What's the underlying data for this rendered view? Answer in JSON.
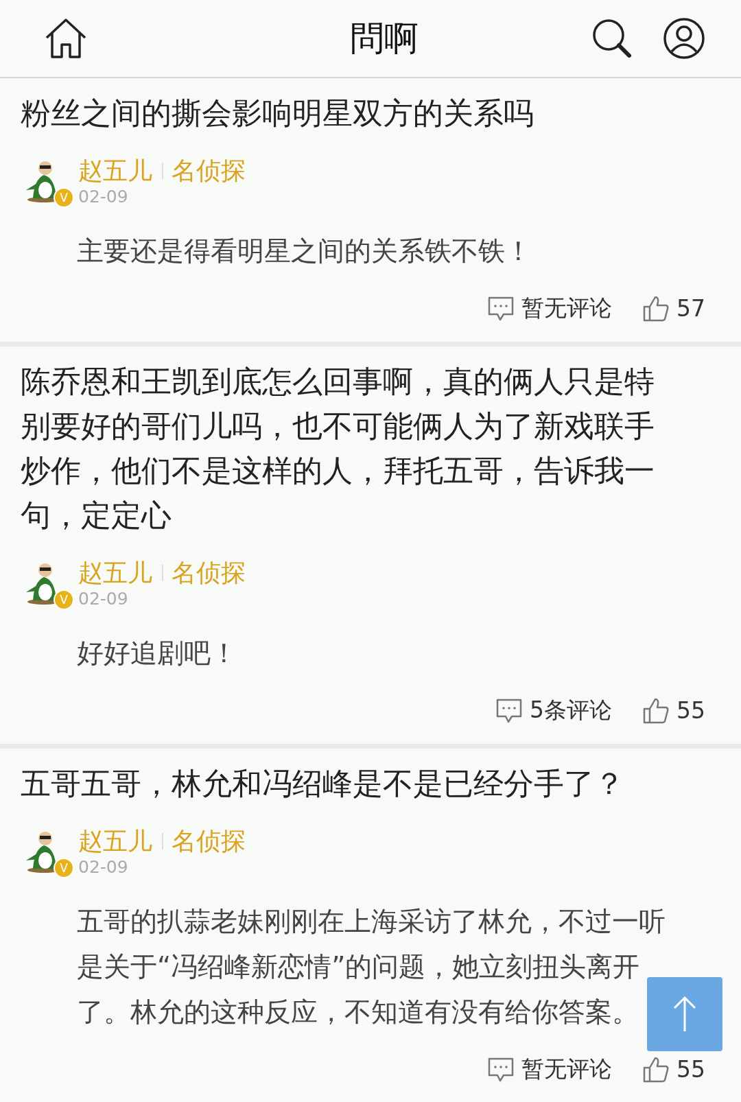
{
  "header": {
    "title": "問啊"
  },
  "posts": [
    {
      "question": "粉丝之间的撕会影响明星双方的关系吗",
      "author": {
        "name": "赵五儿",
        "role": "名侦探",
        "date": "02-09",
        "verified_mark": "V"
      },
      "answer": "主要还是得看明星之间的关系铁不铁！",
      "comments": "暂无评论",
      "likes": "57"
    },
    {
      "question": "陈乔恩和王凯到底怎么回事啊，真的俩人只是特别要好的哥们儿吗，也不可能俩人为了新戏联手炒作，他们不是这样的人，拜托五哥，告诉我一句，定定心",
      "author": {
        "name": "赵五儿",
        "role": "名侦探",
        "date": "02-09",
        "verified_mark": "V"
      },
      "answer": "好好追剧吧！",
      "comments": "5条评论",
      "likes": "55"
    },
    {
      "question": "五哥五哥，林允和冯绍峰是不是已经分手了？",
      "author": {
        "name": "赵五儿",
        "role": "名侦探",
        "date": "02-09",
        "verified_mark": "V"
      },
      "answer": "五哥的扒蒜老妹刚刚在上海采访了林允，不过一听是关于“冯绍峰新恋情”的问题，她立刻扭头离开了。林允的这种反应，不知道有没有给你答案。",
      "comments": "暂无评论",
      "likes": "55"
    }
  ]
}
